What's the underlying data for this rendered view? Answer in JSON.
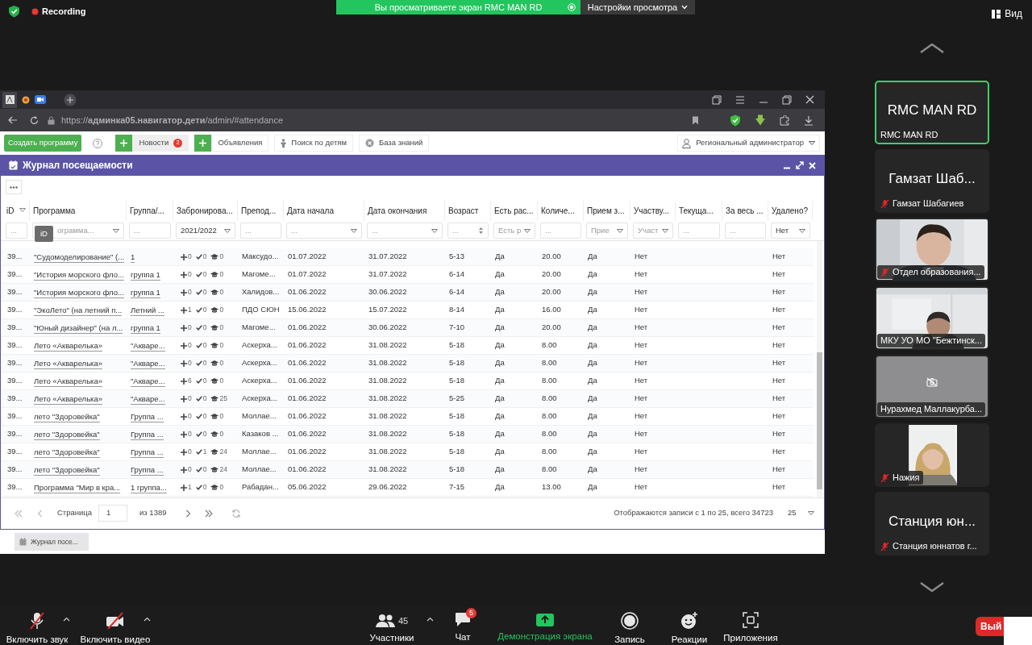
{
  "zoom_top": {
    "recording": "Recording",
    "share_banner": "Вы просматриваете экран RMC MAN RD",
    "view_options": "Настройки просмотра",
    "view_button": "Вид"
  },
  "browser": {
    "url": "https://**админка05.навигатор.дети**/admin/#attendance"
  },
  "app_toolbar": {
    "create_button": "Создать программу",
    "news": "Новости",
    "news_badge": "2",
    "announcements": "Объявления",
    "child_search": "Поиск по детям",
    "knowledge_base": "База знаний",
    "user_role": "Региональный администратор"
  },
  "panel": {
    "title": "Журнал посещаемости",
    "tooltip": "iD",
    "columns": [
      {
        "label": "iD",
        "kind": "text",
        "menu_icon": true,
        "filter": {
          "kind": "text",
          "placeholder": "..."
        }
      },
      {
        "label": "Программа",
        "kind": "link",
        "menu_icon": false,
        "filter": {
          "kind": "select",
          "placeholder": "ограмма..."
        }
      },
      {
        "label": "Группа/...",
        "kind": "link",
        "menu_icon": false,
        "filter": {
          "kind": "text",
          "placeholder": "..."
        }
      },
      {
        "label": "Забронирова...",
        "kind": "counts",
        "menu_icon": false,
        "filter": {
          "kind": "select",
          "value": "2021/2022"
        }
      },
      {
        "label": "Препод...",
        "kind": "text",
        "menu_icon": false,
        "filter": {
          "kind": "text",
          "placeholder": "..."
        }
      },
      {
        "label": "Дата начала",
        "kind": "text",
        "menu_icon": false,
        "filter": {
          "kind": "select",
          "placeholder": "..."
        }
      },
      {
        "label": "Дата окончания",
        "kind": "text",
        "menu_icon": false,
        "filter": {
          "kind": "select",
          "placeholder": "..."
        }
      },
      {
        "label": "Возраст",
        "kind": "text",
        "menu_icon": false,
        "filter": {
          "kind": "spin",
          "placeholder": "..."
        }
      },
      {
        "label": "Есть рас...",
        "kind": "text",
        "menu_icon": false,
        "filter": {
          "kind": "select",
          "placeholder": "Есть р"
        }
      },
      {
        "label": "Количе...",
        "kind": "text",
        "menu_icon": false,
        "filter": {
          "kind": "text",
          "placeholder": "..."
        }
      },
      {
        "label": "Прием з...",
        "kind": "text",
        "menu_icon": false,
        "filter": {
          "kind": "select",
          "placeholder": "Прие"
        }
      },
      {
        "label": "Участву...",
        "kind": "text",
        "menu_icon": false,
        "filter": {
          "kind": "select",
          "placeholder": "Участ"
        }
      },
      {
        "label": "Текуща...",
        "kind": "blank",
        "menu_icon": false,
        "filter": {
          "kind": "text",
          "placeholder": "..."
        }
      },
      {
        "label": "За весь ...",
        "kind": "blank",
        "menu_icon": false,
        "filter": {
          "kind": "text",
          "placeholder": "..."
        }
      },
      {
        "label": "Удалено?",
        "kind": "text",
        "menu_icon": false,
        "filter": {
          "kind": "select",
          "value": "Нет"
        }
      }
    ],
    "rows": [
      {
        "cells": [
          "39...",
          "\"Судомоделирование\" (...",
          "1",
          {
            "plus": "0",
            "check": "0",
            "cap": "0"
          },
          "Максудо...",
          "01.07.2022",
          "31.07.2022",
          "5-13",
          "Да",
          "20.00",
          "Да",
          "Нет",
          "Нет"
        ]
      },
      {
        "cells": [
          "39...",
          "\"История морского фло...",
          "группа 1",
          {
            "plus": "0",
            "check": "0",
            "cap": "0"
          },
          "Магоме...",
          "01.07.2022",
          "31.07.2022",
          "6-14",
          "Да",
          "20.00",
          "Да",
          "Нет",
          "Нет"
        ]
      },
      {
        "cells": [
          "39...",
          "\"История морского фло...",
          "группа 1",
          {
            "plus": "0",
            "check": "0",
            "cap": "0"
          },
          "Халидов...",
          "01.06.2022",
          "30.06.2022",
          "6-14",
          "Да",
          "20.00",
          "Да",
          "Нет",
          "Нет"
        ]
      },
      {
        "cells": [
          "39...",
          "\"ЭкоЛето\" (на летний п...",
          "Летний ...",
          {
            "plus": "1",
            "check": "0",
            "cap": "0"
          },
          "ПДО СЮН",
          "15.06.2022",
          "15.07.2022",
          "8-14",
          "Да",
          "16.00",
          "Да",
          "Нет",
          "Нет"
        ]
      },
      {
        "cells": [
          "39...",
          "\"Юный дизайнер\" (на л...",
          "группа 1",
          {
            "plus": "0",
            "check": "0",
            "cap": "0"
          },
          "Магоме...",
          "01.06.2022",
          "30.06.2022",
          "7-10",
          "Да",
          "20.00",
          "Да",
          "Нет",
          "Нет"
        ]
      },
      {
        "cells": [
          "39...",
          "Лето «Акварелька»",
          "\"Акваре...",
          {
            "plus": "0",
            "check": "0",
            "cap": "0"
          },
          "Аскерха...",
          "01.06.2022",
          "31.08.2022",
          "5-18",
          "Да",
          "8.00",
          "Да",
          "Нет",
          "Нет"
        ]
      },
      {
        "cells": [
          "39...",
          "Лето «Акварелька»",
          "\"Акваре...",
          {
            "plus": "0",
            "check": "0",
            "cap": "0"
          },
          "Аскерха...",
          "01.06.2022",
          "31.08.2022",
          "5-18",
          "Да",
          "8.00",
          "Да",
          "Нет",
          "Нет"
        ]
      },
      {
        "cells": [
          "39...",
          "Лето «Акварелька»",
          "\"Акваре...",
          {
            "plus": "6",
            "check": "0",
            "cap": "0"
          },
          "Аскерха...",
          "01.06.2022",
          "31.08.2022",
          "5-18",
          "Да",
          "8.00",
          "Да",
          "Нет",
          "Нет"
        ]
      },
      {
        "cells": [
          "39...",
          "Лето «Акварелька»",
          "\"Акваре...",
          {
            "plus": "0",
            "check": "0",
            "cap": "25"
          },
          "Аскерха...",
          "01.06.2022",
          "31.08.2022",
          "5-25",
          "Да",
          "8.00",
          "Да",
          "Нет",
          "Нет"
        ]
      },
      {
        "cells": [
          "39...",
          "лето \"Здоровейка\"",
          "Группа ...",
          {
            "plus": "0",
            "check": "0",
            "cap": "0"
          },
          "Моллае...",
          "01.06.2022",
          "31.08.2022",
          "5-18",
          "Да",
          "8.00",
          "Да",
          "Нет",
          "Нет"
        ]
      },
      {
        "cells": [
          "39...",
          "лето \"Здоровейка\"",
          "Группа ...",
          {
            "plus": "0",
            "check": "0",
            "cap": "0"
          },
          "Казаков ...",
          "01.06.2022",
          "31.08.2022",
          "5-18",
          "Да",
          "8.00",
          "Да",
          "Нет",
          "Нет"
        ]
      },
      {
        "cells": [
          "39...",
          "лето \"Здоровейка\"",
          "Группа ...",
          {
            "plus": "0",
            "check": "1",
            "cap": "24"
          },
          "Моллае...",
          "01.06.2022",
          "31.08.2022",
          "5-18",
          "Да",
          "8.00",
          "Да",
          "Нет",
          "Нет"
        ]
      },
      {
        "cells": [
          "39...",
          "лето \"Здоровейка\"",
          "Группа ...",
          {
            "plus": "0",
            "check": "0",
            "cap": "24"
          },
          "Моллае...",
          "01.06.2022",
          "31.08.2022",
          "5-18",
          "Да",
          "8.00",
          "Да",
          "Нет",
          "Нет"
        ]
      },
      {
        "cells": [
          "39...",
          "Программа \"Мир в кра...",
          "1 группа...",
          {
            "plus": "1",
            "check": "0",
            "cap": "0"
          },
          "Рабадан...",
          "05.06.2022",
          "29.06.2022",
          "7-15",
          "Да",
          "13.00",
          "Да",
          "Нет",
          "Нет"
        ]
      }
    ],
    "pager": {
      "page_label": "Страница",
      "page": "1",
      "page_count": "из 1389",
      "summary": "Отображаются записи с 1 по 25, всего 34723",
      "page_size": "25"
    }
  },
  "taskbar": {
    "item": "Журнал посе..."
  },
  "participants": [
    {
      "kind": "name",
      "big_name": "RMC MAN RD",
      "name": "RMC MAN RD",
      "muted": false,
      "active_speaker": true
    },
    {
      "kind": "name",
      "big_name": "Гамзат Шаб...",
      "name": "Гамзат Шабагиев",
      "muted": true,
      "active_speaker": false
    },
    {
      "kind": "video",
      "name": "Отдел образования...",
      "muted": true,
      "active_speaker": false
    },
    {
      "kind": "video",
      "name": "МКУ УО МО \"Бежтинск...",
      "muted": false,
      "active_speaker": false
    },
    {
      "kind": "camera_off",
      "name": "Нурахмед Маллакурба...",
      "muted": false,
      "active_speaker": false
    },
    {
      "kind": "portrait_video",
      "name": "Нажия",
      "muted": true,
      "active_speaker": false
    },
    {
      "kind": "name",
      "big_name": "Станция юн...",
      "name": "Станция юннатов г...",
      "muted": true,
      "active_speaker": false
    }
  ],
  "controls": {
    "mic": {
      "label": "Включить звук",
      "muted": true
    },
    "video": {
      "label": "Включить видео",
      "off": true
    },
    "participants": {
      "label": "Участники",
      "count": "45"
    },
    "chat": {
      "label": "Чат",
      "badge": "5"
    },
    "share": {
      "label": "Демонстрация экрана"
    },
    "record": {
      "label": "Запись"
    },
    "reactions": {
      "label": "Реакции"
    },
    "apps": {
      "label": "Приложения"
    },
    "leave": {
      "label": "Вый"
    }
  }
}
